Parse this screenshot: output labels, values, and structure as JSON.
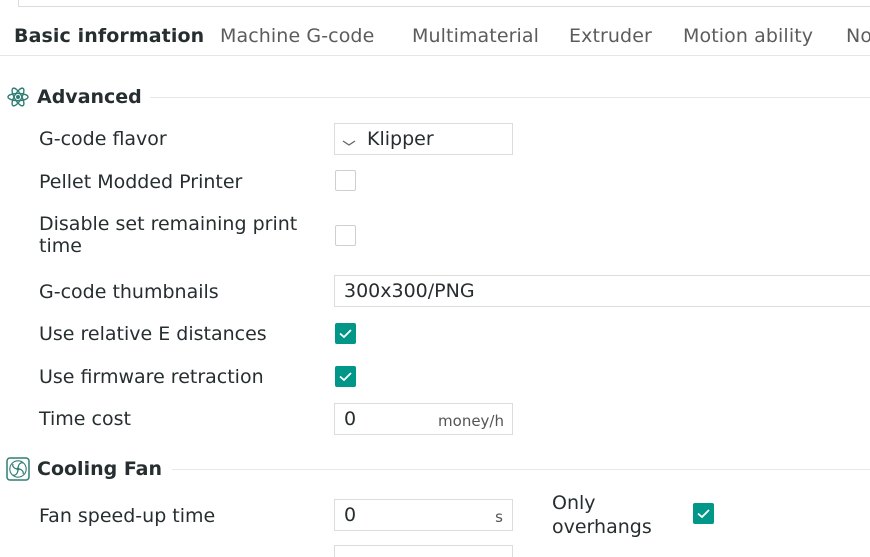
{
  "tabs": [
    {
      "label": "Basic information",
      "active": true
    },
    {
      "label": "Machine G-code",
      "active": false
    },
    {
      "label": "Multimaterial",
      "active": false
    },
    {
      "label": "Extruder",
      "active": false
    },
    {
      "label": "Motion ability",
      "active": false
    },
    {
      "label": "No",
      "active": false
    }
  ],
  "sections": {
    "advanced": {
      "title": "Advanced",
      "icon": "atom-icon",
      "rows": {
        "gcode_flavor": {
          "label": "G-code flavor",
          "value": "Klipper"
        },
        "pellet_modded": {
          "label": "Pellet Modded Printer",
          "checked": false
        },
        "disable_remaining": {
          "label": "Disable set remaining print time",
          "checked": false
        },
        "thumbnails": {
          "label": "G-code thumbnails",
          "value": "300x300/PNG"
        },
        "relative_e": {
          "label": "Use relative E distances",
          "checked": true
        },
        "firmware_retraction": {
          "label": "Use firmware retraction",
          "checked": true
        },
        "time_cost": {
          "label": "Time cost",
          "value": "0",
          "unit": "money/h"
        }
      }
    },
    "cooling_fan": {
      "title": "Cooling Fan",
      "icon": "fan-icon",
      "rows": {
        "fan_speedup": {
          "label": "Fan speed-up time",
          "value": "0",
          "unit": "s"
        },
        "only_overhangs": {
          "label": "Only overhangs",
          "checked": true
        }
      }
    }
  },
  "colors": {
    "accent": "#009688",
    "text": "#262e30",
    "muted_text": "#5c5c5c",
    "border": "#dcdcdc"
  }
}
